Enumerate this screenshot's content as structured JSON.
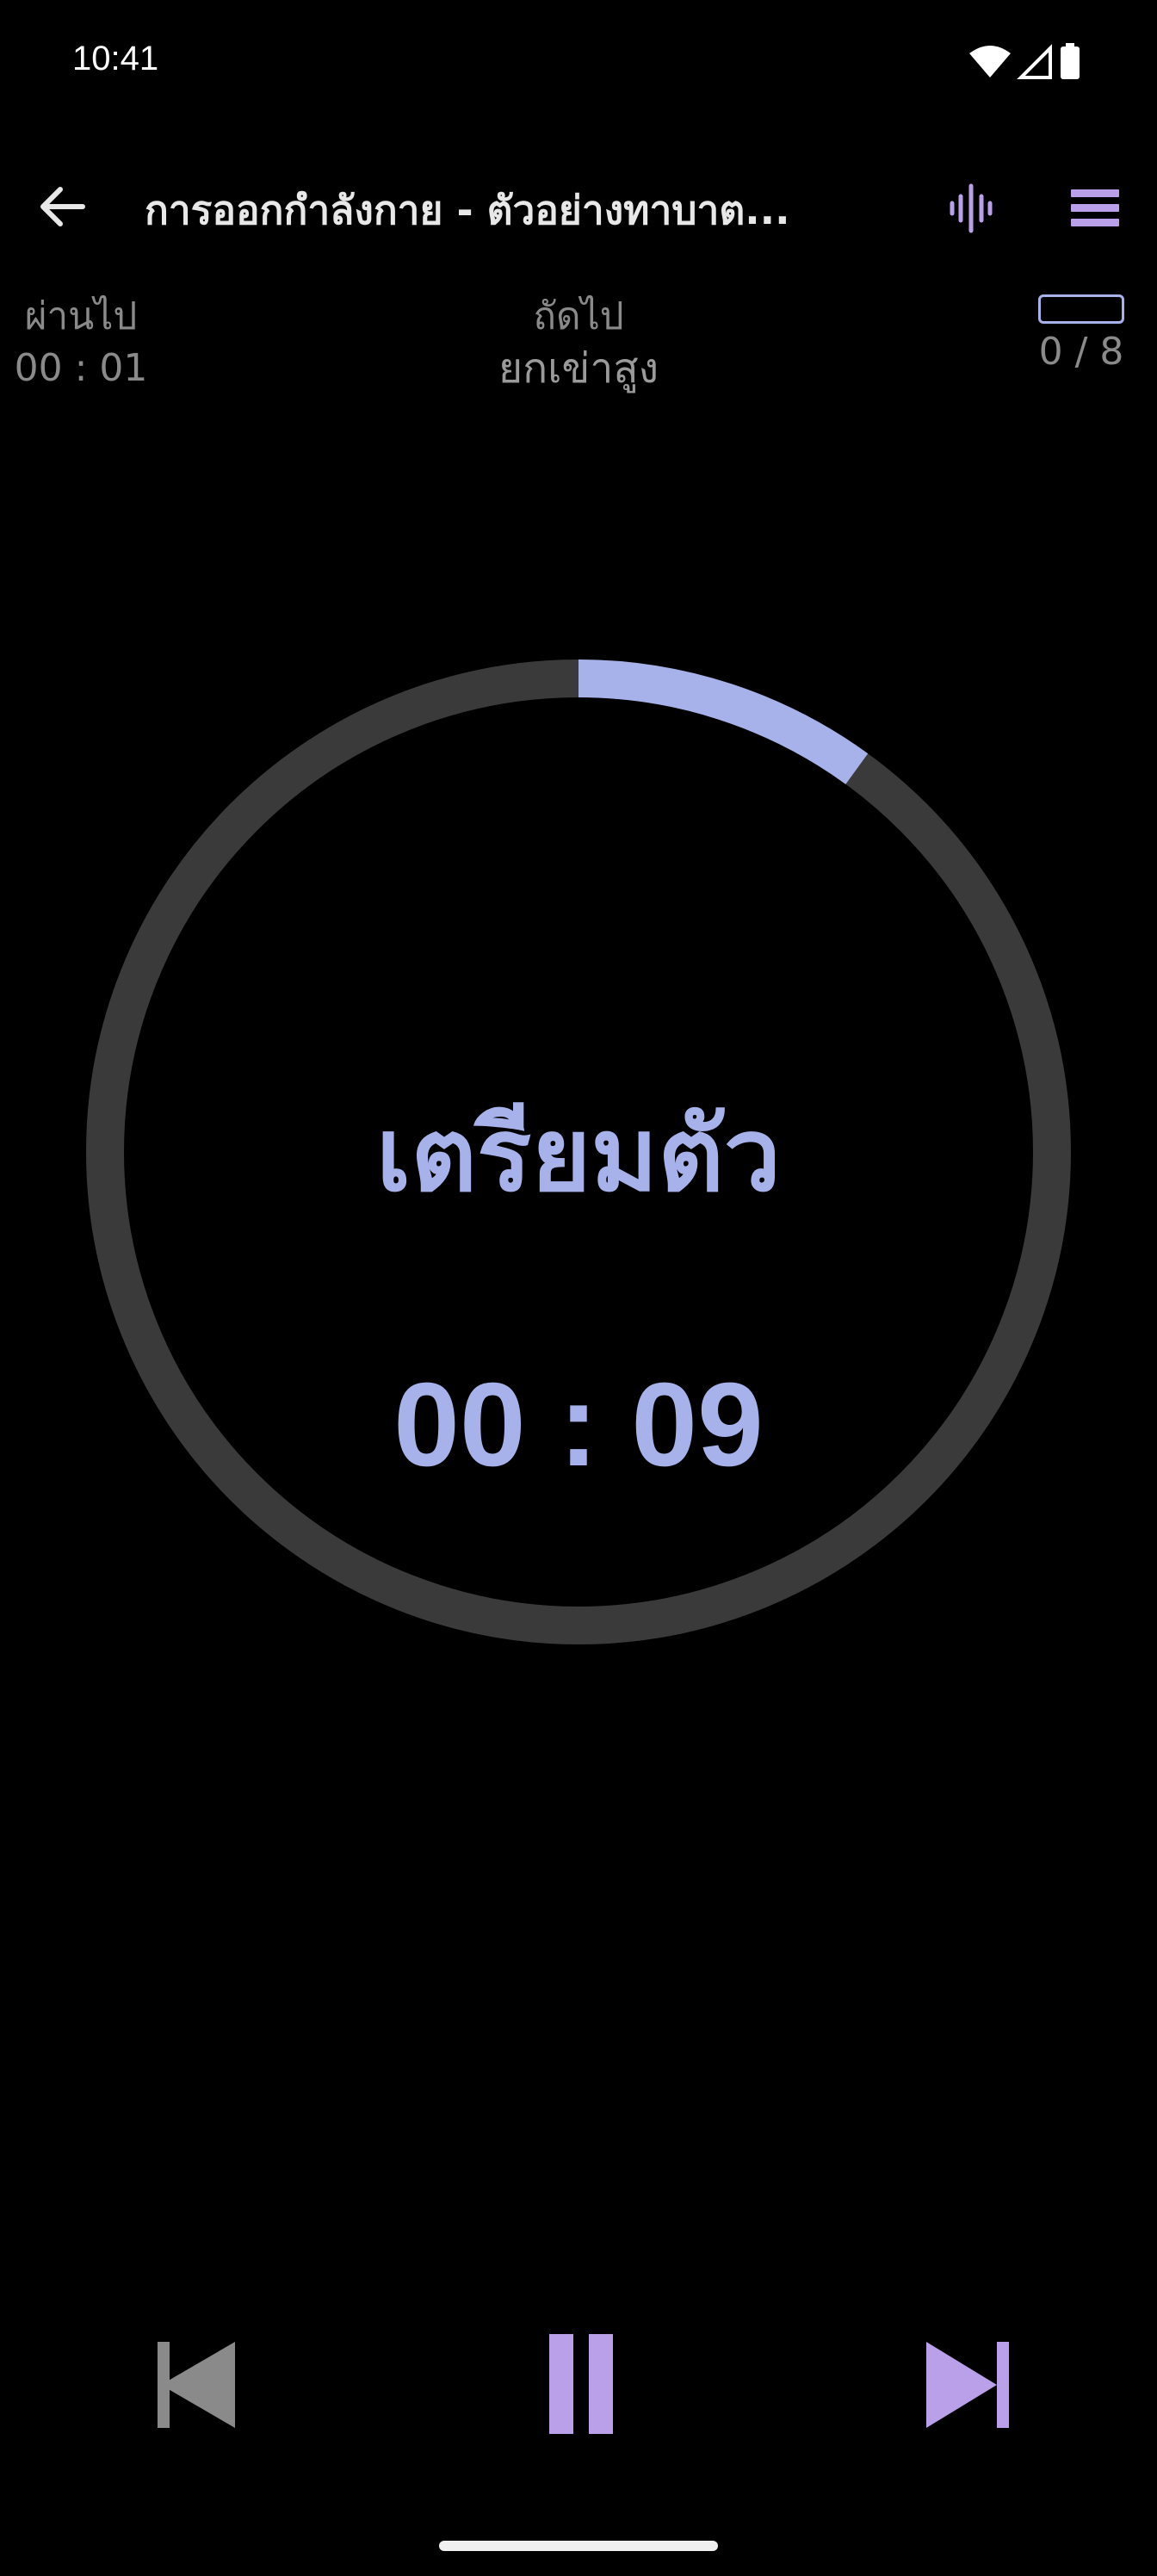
{
  "status_bar": {
    "time": "10:41",
    "icons": [
      "wifi-icon",
      "signal-icon",
      "battery-icon"
    ]
  },
  "app_bar": {
    "title": "การออกกำลังกาย - ตัวอย่างทาบาต...",
    "back_icon": "arrow-left-icon",
    "voice_icon": "voice-waveform-icon",
    "menu_icon": "menu-icon"
  },
  "info": {
    "elapsed_label": "ผ่านไป",
    "elapsed_time": "00 : 01",
    "next_label": "ถัดไป",
    "next_exercise": "ยกเข่าสูง",
    "round_progress": "0 / 8",
    "round_progress_fraction": 0
  },
  "timer": {
    "phase": "เตรียมตัว",
    "remaining": "00 : 09",
    "progress_fraction": 0.1
  },
  "controls": {
    "previous_icon": "skip-previous-icon",
    "pause_icon": "pause-icon",
    "next_icon": "skip-next-icon"
  },
  "colors": {
    "accent": "#a7b2ea",
    "accent_purple": "#b9a0e8",
    "ring_track": "#3a3a3a",
    "muted_text": "#8a8a8a",
    "disabled_icon": "#8a8a8a",
    "background": "#000000"
  }
}
